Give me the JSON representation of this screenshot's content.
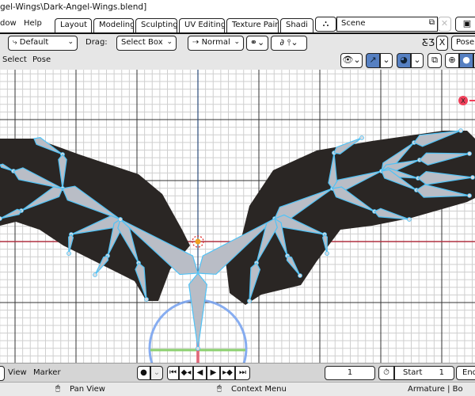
{
  "window": {
    "title": "gel-Wings\\Dark-Angel-Wings.blend]"
  },
  "menu": {
    "window": "dow",
    "help": "Help"
  },
  "workspaces": [
    {
      "label": "Layout",
      "active": true
    },
    {
      "label": "Modeling"
    },
    {
      "label": "Sculpting"
    },
    {
      "label": "UV Editing"
    },
    {
      "label": "Texture Paint"
    },
    {
      "label": "Shadi"
    }
  ],
  "scene": {
    "name": "Scene"
  },
  "toolbar": {
    "orientation": "Default",
    "drag_label": "Drag:",
    "drag_value": "Select Box",
    "pivot": "Normal",
    "mode": "Pose"
  },
  "viewport_menu": {
    "select": "Select",
    "pose": "Pose"
  },
  "gizmo": {
    "x_label": "X"
  },
  "timeline": {
    "view": "View",
    "marker": "Marker",
    "current_frame": "1",
    "start_label": "Start",
    "start_value": "1",
    "end_label": "End"
  },
  "statusbar": {
    "pan": "Pan View",
    "context": "Context Menu",
    "info": "Armature | Bo"
  },
  "colors": {
    "accent": "#5680c2",
    "bone_outline": "#4fc3f7",
    "x_axis": "#b03040",
    "gizmo_x": "#f0405a"
  }
}
